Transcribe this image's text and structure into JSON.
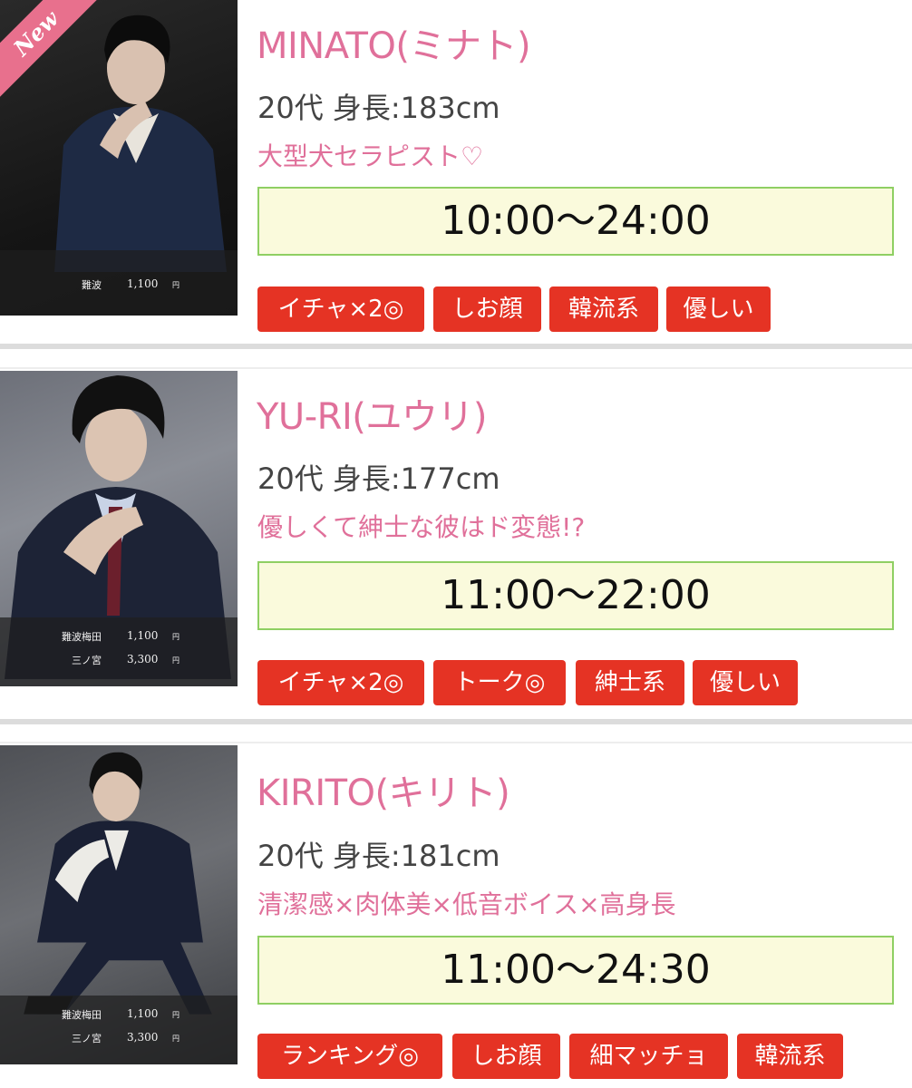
{
  "cards": [
    {
      "name": "MINATO(ミナト)",
      "info": "20代 身長:183cm",
      "catch": "大型犬セラピスト♡",
      "hours": "10:00〜24:00",
      "badge": "New",
      "prices": [
        {
          "area": "難波",
          "amount": "1,100",
          "unit": "円"
        }
      ],
      "tags": [
        "イチャ×2◎",
        "しお顔",
        "韓流系",
        "優しい"
      ]
    },
    {
      "name": "YU-RI(ユウリ)",
      "info": "20代 身長:177cm",
      "catch": "優しくて紳士な彼はド変態!?",
      "hours": "11:00〜22:00",
      "prices": [
        {
          "area": "難波梅田",
          "amount": "1,100",
          "unit": "円"
        },
        {
          "area": "三ノ宮",
          "amount": "3,300",
          "unit": "円"
        }
      ],
      "tags": [
        "イチャ×2◎",
        "トーク◎",
        "紳士系",
        "優しい"
      ]
    },
    {
      "name": "KIRITO(キリト)",
      "info": "20代 身長:181cm",
      "catch": "清潔感×肉体美×低音ボイス×高身長",
      "hours": "11:00〜24:30",
      "prices": [
        {
          "area": "難波梅田",
          "amount": "1,100",
          "unit": "円"
        },
        {
          "area": "三ノ宮",
          "amount": "3,300",
          "unit": "円"
        }
      ],
      "tags": [
        "ランキング◎",
        "しお顔",
        "細マッチョ",
        "韓流系"
      ]
    }
  ]
}
